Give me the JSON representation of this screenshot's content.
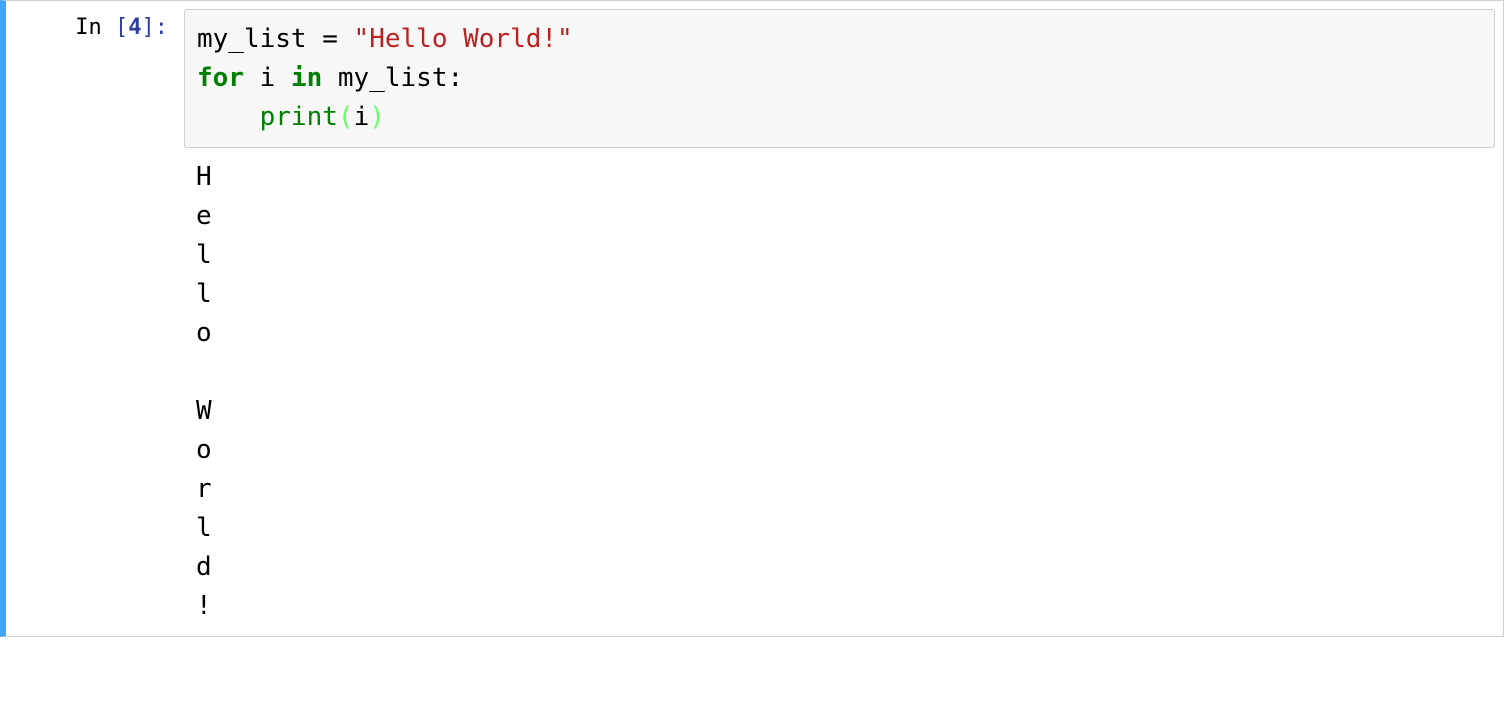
{
  "cell": {
    "prompt": {
      "label": "In ",
      "open_bracket": "[",
      "number": "4",
      "close_bracket": "]:"
    },
    "code": {
      "line1_var": "my_list ",
      "line1_eq": "= ",
      "line1_str": "\"Hello World!\"",
      "line2_kw_for": "for",
      "line2_sp1": " i ",
      "line2_kw_in": "in",
      "line2_rest": " my_list:",
      "line3_indent": "    ",
      "line3_print": "print",
      "line3_open": "(",
      "line3_arg": "i",
      "line3_close": ")"
    },
    "output": "H\ne\nl\nl\no\n \nW\no\nr\nl\nd\n!"
  }
}
